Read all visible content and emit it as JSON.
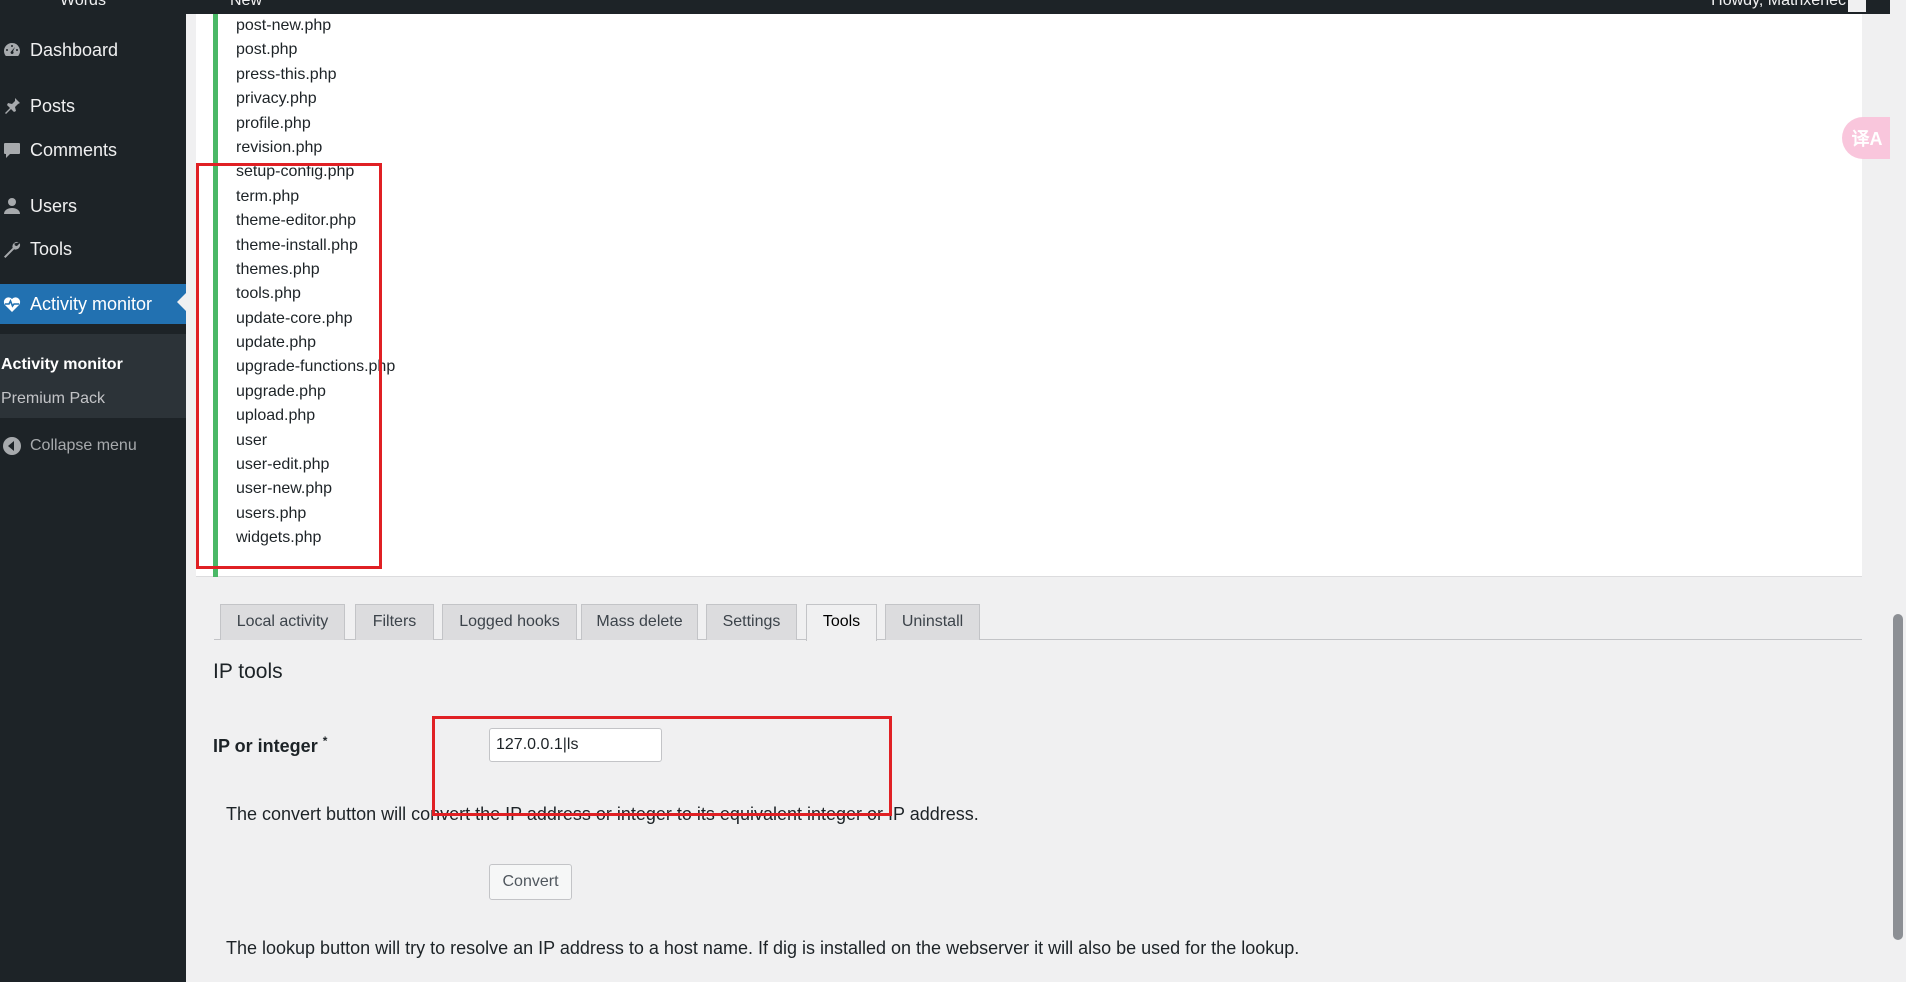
{
  "adminbar": {
    "site_title": "Words",
    "new_label": "New",
    "greeting": "Howdy, Matrixenec"
  },
  "sidebar": {
    "items": [
      {
        "label": "Dashboard",
        "icon": "dashboard-icon"
      },
      {
        "label": "Posts",
        "icon": "pin-icon"
      },
      {
        "label": "Comments",
        "icon": "comment-icon"
      },
      {
        "label": "Users",
        "icon": "user-icon"
      },
      {
        "label": "Tools",
        "icon": "wrench-icon"
      },
      {
        "label": "Activity monitor",
        "icon": "heart-pulse-icon",
        "current": true
      }
    ],
    "submenu": [
      {
        "label": "Activity monitor",
        "active": true
      },
      {
        "label": "Premium Pack"
      }
    ],
    "collapse_label": "Collapse menu"
  },
  "files": [
    "post-new.php",
    "post.php",
    "press-this.php",
    "privacy.php",
    "profile.php",
    "revision.php",
    "setup-config.php",
    "term.php",
    "theme-editor.php",
    "theme-install.php",
    "themes.php",
    "tools.php",
    "update-core.php",
    "update.php",
    "upgrade-functions.php",
    "upgrade.php",
    "upload.php",
    "user",
    "user-edit.php",
    "user-new.php",
    "users.php",
    "widgets.php"
  ],
  "tabs": [
    {
      "label": "Local activity"
    },
    {
      "label": "Filters"
    },
    {
      "label": "Logged hooks"
    },
    {
      "label": "Mass delete"
    },
    {
      "label": "Settings"
    },
    {
      "label": "Tools",
      "active": true
    },
    {
      "label": "Uninstall"
    }
  ],
  "ip_tools": {
    "title": "IP tools",
    "field_label": "IP or integer",
    "required_mark": "*",
    "input_value": "127.0.0.1|ls",
    "convert_desc": "The convert button will convert the IP address or integer to its equivalent integer or IP address.",
    "convert_label": "Convert",
    "lookup_desc": "The lookup button will try to resolve an IP address to a host name. If dig is installed on the webserver it will also be used for the lookup."
  },
  "translate_badge": "译A",
  "colors": {
    "sidebar_bg": "#1d2327",
    "accent": "#2271b1",
    "green_bar": "#4ab866",
    "highlight": "#e02024"
  }
}
